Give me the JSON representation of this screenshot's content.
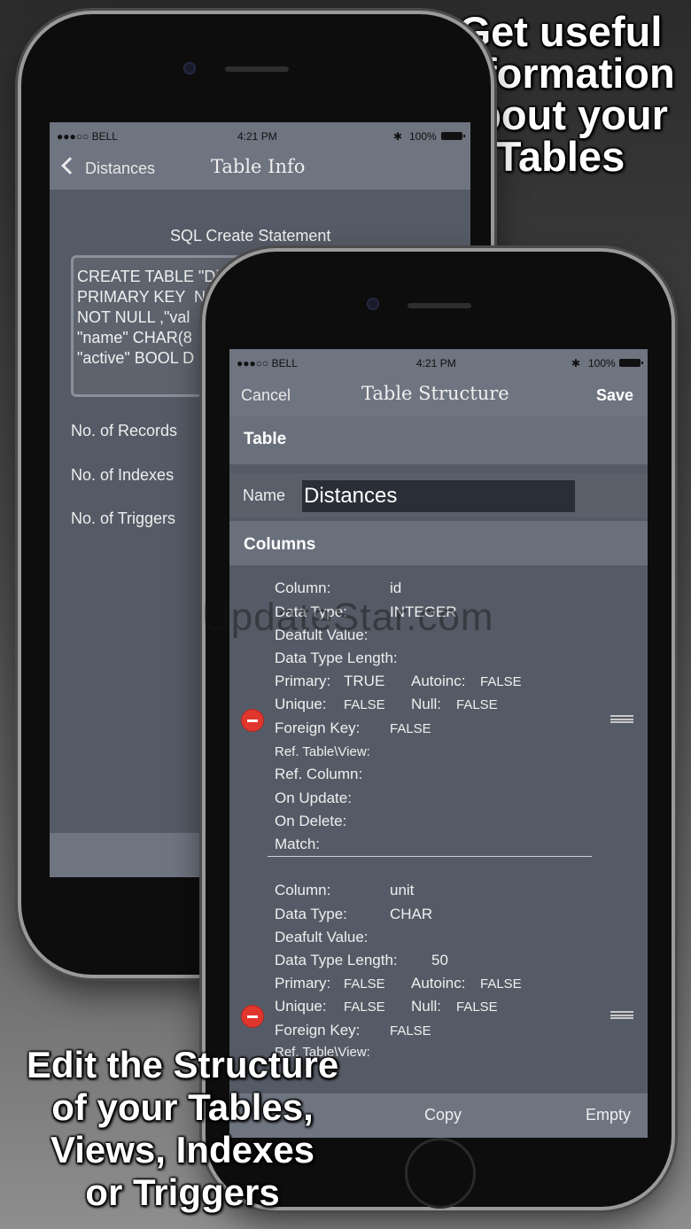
{
  "promo": {
    "top_lines": [
      "Get useful",
      "Information",
      "about your",
      "Tables"
    ],
    "bottom_lines": [
      "Edit the Structure",
      "of your Tables,",
      "Views, Indexes",
      "or Triggers"
    ]
  },
  "watermark": "UpdateStar.com",
  "status_bar": {
    "carrier": "●●●○○ BELL",
    "time": "4:21 PM",
    "battery": "100%"
  },
  "back_screen": {
    "nav": {
      "back_label": "Distances",
      "title": "Table Info"
    },
    "sql_heading": "SQL Create Statement",
    "sql_text": "CREATE TABLE \"Di\nPRIMARY KEY  N\nNOT NULL ,\"val\n\"name\" CHAR(8\n\"active\" BOOL D",
    "rows": [
      "No. of Records",
      "No. of Indexes",
      "No. of Triggers"
    ]
  },
  "front_screen": {
    "nav": {
      "cancel_label": "Cancel",
      "title": "Table Structure",
      "save_label": "Save"
    },
    "table_section": "Table",
    "name_label": "Name",
    "name_value": "Distances",
    "columns_section": "Columns",
    "columns": [
      {
        "column_label": "Column:",
        "column_value": "id",
        "type_label": "Data Type:",
        "type_value": "INTEGER",
        "default_label": "Deafult Value:",
        "default_value": "",
        "length_label": "Data Type Length:",
        "length_value": "",
        "primary_label": "Primary:",
        "primary_value": "TRUE",
        "autoinc_label": "Autoinc:",
        "autoinc_value": "FALSE",
        "unique_label": "Unique:",
        "unique_value": "FALSE",
        "null_label": "Null:",
        "null_value": "FALSE",
        "fk_label": "Foreign Key:",
        "fk_value": "FALSE",
        "ref_table_label": "Ref. Table\\View:",
        "ref_column_label": "Ref. Column:",
        "on_update_label": "On Update:",
        "on_delete_label": "On Delete:",
        "match_label": "Match:"
      },
      {
        "column_label": "Column:",
        "column_value": "unit",
        "type_label": "Data Type:",
        "type_value": "CHAR",
        "default_label": "Deafult Value:",
        "default_value": "",
        "length_label": "Data Type Length:",
        "length_value": "50",
        "primary_label": "Primary:",
        "primary_value": "FALSE",
        "autoinc_label": "Autoinc:",
        "autoinc_value": "FALSE",
        "unique_label": "Unique:",
        "unique_value": "FALSE",
        "null_label": "Null:",
        "null_value": "FALSE",
        "fk_label": "Foreign Key:",
        "fk_value": "FALSE",
        "ref_table_label": "Ref. Table\\View:"
      }
    ],
    "toolbar": {
      "copy_label": "Copy",
      "empty_label": "Empty"
    }
  }
}
